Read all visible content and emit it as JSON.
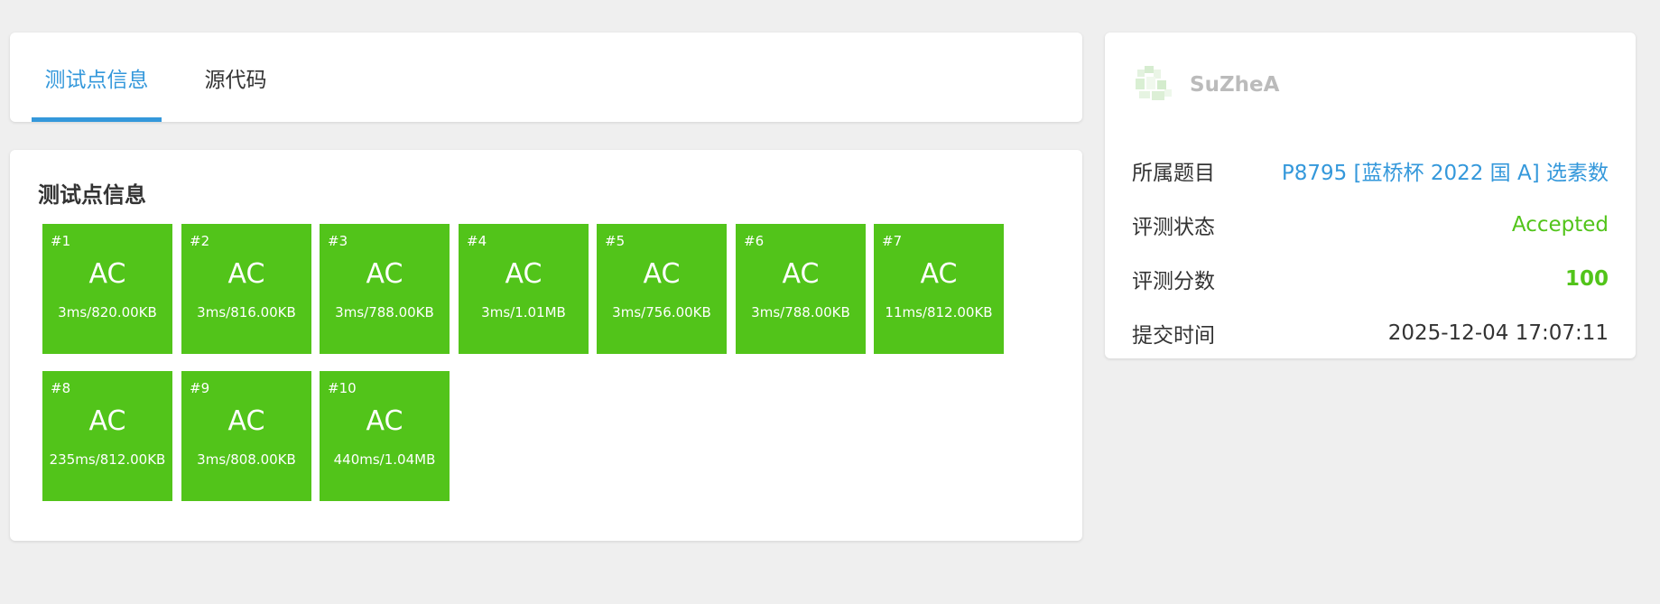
{
  "tabs": [
    {
      "label": "测试点信息",
      "active": true
    },
    {
      "label": "源代码",
      "active": false
    }
  ],
  "testpoints": {
    "title": "测试点信息",
    "items": [
      {
        "num": "#1",
        "status": "AC",
        "detail": "3ms/820.00KB"
      },
      {
        "num": "#2",
        "status": "AC",
        "detail": "3ms/816.00KB"
      },
      {
        "num": "#3",
        "status": "AC",
        "detail": "3ms/788.00KB"
      },
      {
        "num": "#4",
        "status": "AC",
        "detail": "3ms/1.01MB"
      },
      {
        "num": "#5",
        "status": "AC",
        "detail": "3ms/756.00KB"
      },
      {
        "num": "#6",
        "status": "AC",
        "detail": "3ms/788.00KB"
      },
      {
        "num": "#7",
        "status": "AC",
        "detail": "11ms/812.00KB"
      },
      {
        "num": "#8",
        "status": "AC",
        "detail": "235ms/812.00KB"
      },
      {
        "num": "#9",
        "status": "AC",
        "detail": "3ms/808.00KB"
      },
      {
        "num": "#10",
        "status": "AC",
        "detail": "440ms/1.04MB"
      }
    ]
  },
  "info": {
    "username": "SuZheA",
    "problem_label": "所属题目",
    "problem_value": "P8795 [蓝桥杯 2022 国 A] 选素数",
    "status_label": "评测状态",
    "status_value": "Accepted",
    "score_label": "评测分数",
    "score_value": "100",
    "time_label": "提交时间",
    "time_value": "2025-12-04 17:07:11"
  },
  "colors": {
    "accent": "#3498db",
    "accepted": "#52c41a"
  }
}
